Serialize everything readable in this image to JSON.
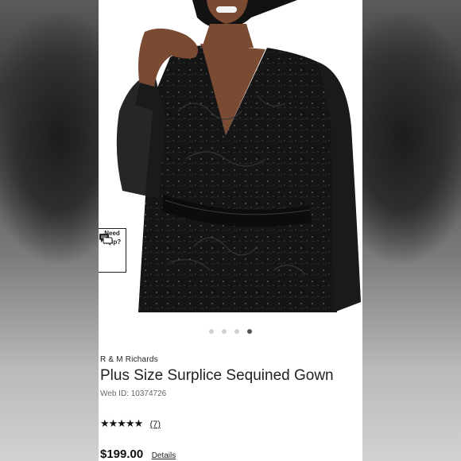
{
  "product": {
    "brand": "R & M Richards",
    "title": "Plus Size Surplice Sequined Gown",
    "web_id": "Web ID: 10374726",
    "rating_stars": "★★★★★",
    "review_count": "(7)",
    "price": "$199.00",
    "details_label": "Details"
  },
  "help_widget": {
    "line1": "Need",
    "line2": "Help?",
    "icon": "chat-bubbles-icon"
  },
  "carousel": {
    "total": 4,
    "active_index": 3
  },
  "colors": {
    "dress": "#141414",
    "skin": "#7a4a33",
    "hair": "#121212",
    "active_dot": "#555555",
    "inactive_dot": "#cfcfcf"
  }
}
